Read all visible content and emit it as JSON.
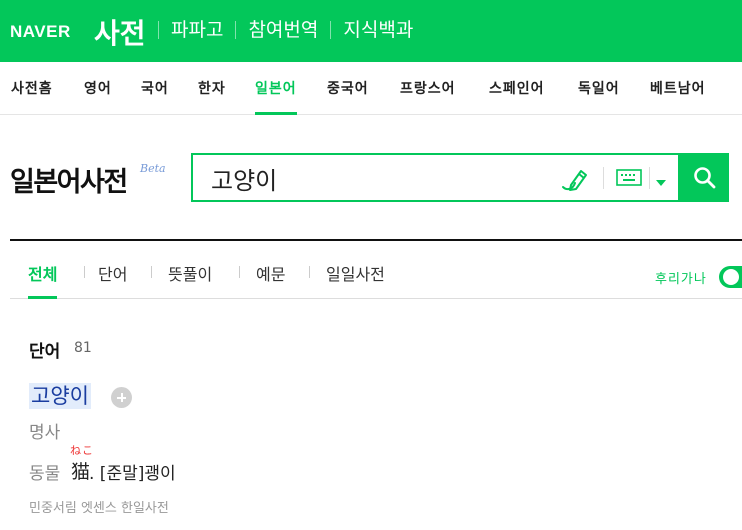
{
  "header": {
    "logo": "NAVER",
    "service": "사전",
    "links": [
      "파파고",
      "참여번역",
      "지식백과"
    ],
    "brand_color": "#03c75a"
  },
  "dict_nav": {
    "items": [
      "사전홈",
      "영어",
      "국어",
      "한자",
      "일본어",
      "중국어",
      "프랑스어",
      "스페인어",
      "독일어",
      "베트남어"
    ],
    "active": "일본어"
  },
  "search": {
    "title": "일본어사전",
    "beta": "Beta",
    "query": "고양이",
    "icons": [
      "handwriting-pen-icon",
      "keyboard-icon",
      "dropdown-arrow-icon",
      "search-icon"
    ]
  },
  "tabs": {
    "items": [
      "전체",
      "단어",
      "뜻풀이",
      "예문",
      "일일사전"
    ],
    "active": "전체",
    "furigana_label": "후리가나",
    "furigana_on": true
  },
  "results": {
    "section_title": "단어",
    "section_count": "81",
    "entry": {
      "word": "고양이",
      "pos": "명사",
      "meaning_prefix": "동물",
      "meaning_kanji": "猫",
      "ruby": "ねこ",
      "meaning_rest": ". [준말]괭이",
      "source": "민중서림 엣센스 한일사전"
    }
  }
}
